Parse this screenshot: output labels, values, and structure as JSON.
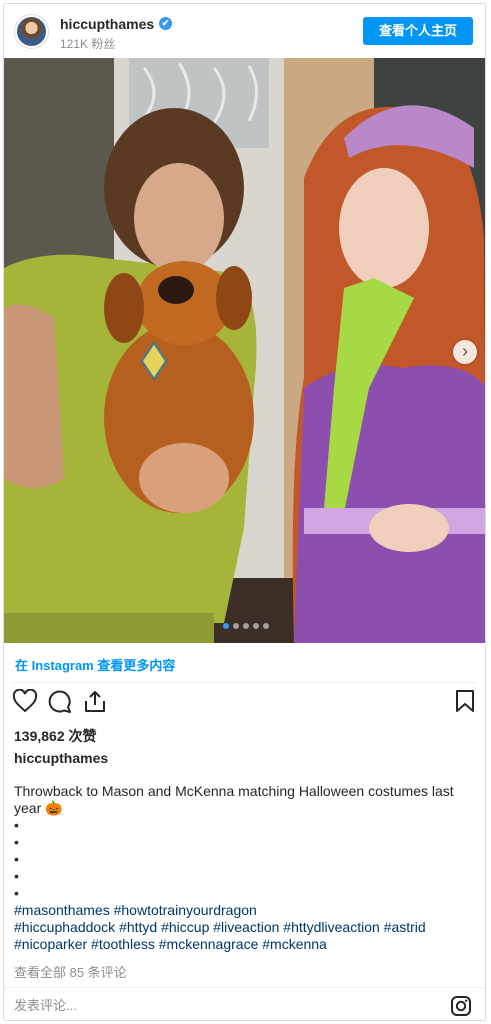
{
  "header": {
    "username": "hiccupthames",
    "verified_mark": "✔",
    "followers": "121K 粉丝",
    "profile_button": "查看个人主页"
  },
  "carousel": {
    "slide_count": 5,
    "active_index": 0,
    "next_icon": "chevron-right-icon",
    "next_glyph": "›"
  },
  "more_link": "在 Instagram 查看更多内容",
  "actions": {
    "icons": [
      "heart-icon",
      "comment-icon",
      "share-icon",
      "bookmark-icon"
    ]
  },
  "likes": "139,862 次赞",
  "owner": "hiccupthames",
  "caption": {
    "text": "Throwback to Mason and McKenna matching Halloween costumes last year 🎃",
    "bullets": [
      "•",
      "•",
      "•",
      "•",
      "•"
    ],
    "hashtags_line1": "#masonthames #howtotrainyourdragon",
    "hashtags_line2": "#hiccuphaddock #httyd #hiccup #liveaction #httydliveaction #astrid",
    "hashtags_line3": "#nicoparker #toothless #mckennagrace #mckenna"
  },
  "comments_link": "查看全部 85 条评论",
  "comment_input": {
    "placeholder": "发表评论..."
  },
  "colors": {
    "accent": "#0095f6",
    "link": "#00376b",
    "muted": "#8e8e8e"
  }
}
